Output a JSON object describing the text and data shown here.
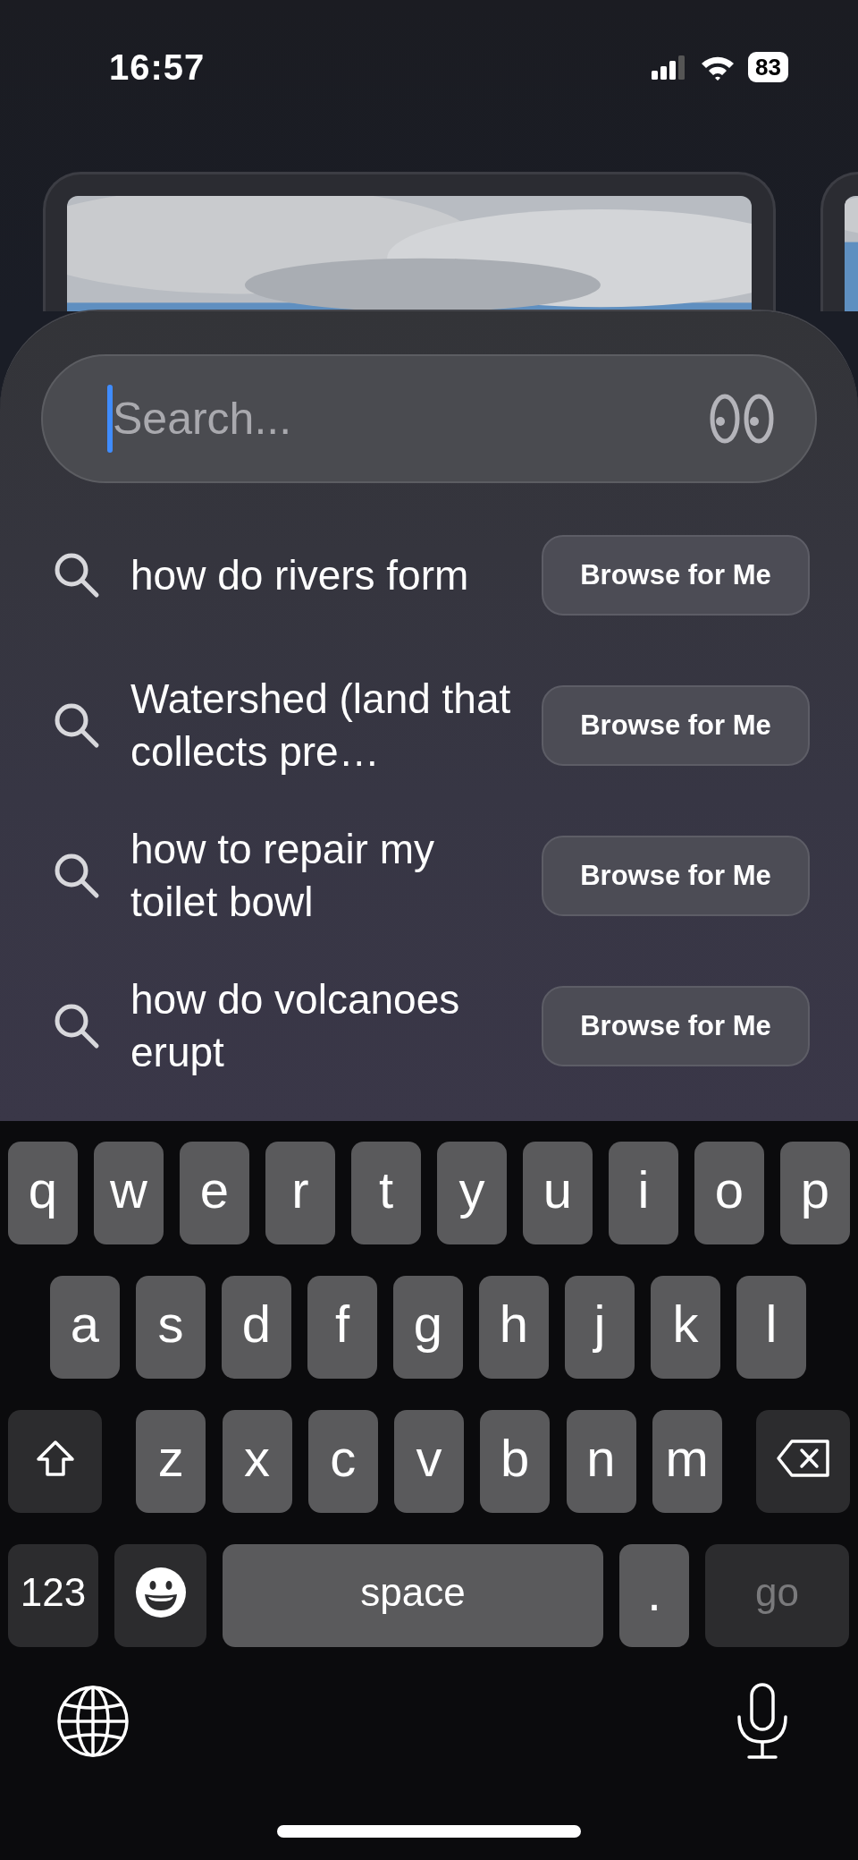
{
  "status_bar": {
    "time": "16:57",
    "battery": "83"
  },
  "search": {
    "placeholder": "Search..."
  },
  "suggestions": [
    {
      "text": "how do rivers form",
      "button": "Browse for Me"
    },
    {
      "text": "Watershed (land that collects pre…",
      "button": "Browse for Me"
    },
    {
      "text": "how to repair my toilet bowl",
      "button": "Browse for Me"
    },
    {
      "text": "how do volcanoes erupt",
      "button": "Browse for Me"
    }
  ],
  "keyboard": {
    "rows": [
      [
        {
          "kind": "letter",
          "label": "q"
        },
        {
          "kind": "letter",
          "label": "w"
        },
        {
          "kind": "letter",
          "label": "e"
        },
        {
          "kind": "letter",
          "label": "r"
        },
        {
          "kind": "letter",
          "label": "t"
        },
        {
          "kind": "letter",
          "label": "y"
        },
        {
          "kind": "letter",
          "label": "u"
        },
        {
          "kind": "letter",
          "label": "i"
        },
        {
          "kind": "letter",
          "label": "o"
        },
        {
          "kind": "letter",
          "label": "p"
        }
      ],
      [
        {
          "kind": "letter",
          "label": "a"
        },
        {
          "kind": "letter",
          "label": "s"
        },
        {
          "kind": "letter",
          "label": "d"
        },
        {
          "kind": "letter",
          "label": "f"
        },
        {
          "kind": "letter",
          "label": "g"
        },
        {
          "kind": "letter",
          "label": "h"
        },
        {
          "kind": "letter",
          "label": "j"
        },
        {
          "kind": "letter",
          "label": "k"
        },
        {
          "kind": "letter",
          "label": "l"
        }
      ],
      [
        {
          "kind": "shift"
        },
        {
          "kind": "letter",
          "label": "z"
        },
        {
          "kind": "letter",
          "label": "x"
        },
        {
          "kind": "letter",
          "label": "c"
        },
        {
          "kind": "letter",
          "label": "v"
        },
        {
          "kind": "letter",
          "label": "b"
        },
        {
          "kind": "letter",
          "label": "n"
        },
        {
          "kind": "letter",
          "label": "m"
        },
        {
          "kind": "delete"
        }
      ]
    ],
    "bottom_row": [
      {
        "kind": "numbers",
        "label": "123"
      },
      {
        "kind": "emoji"
      },
      {
        "kind": "space",
        "label": "space"
      },
      {
        "kind": "period",
        "label": "."
      },
      {
        "kind": "go",
        "label": "go"
      }
    ]
  }
}
